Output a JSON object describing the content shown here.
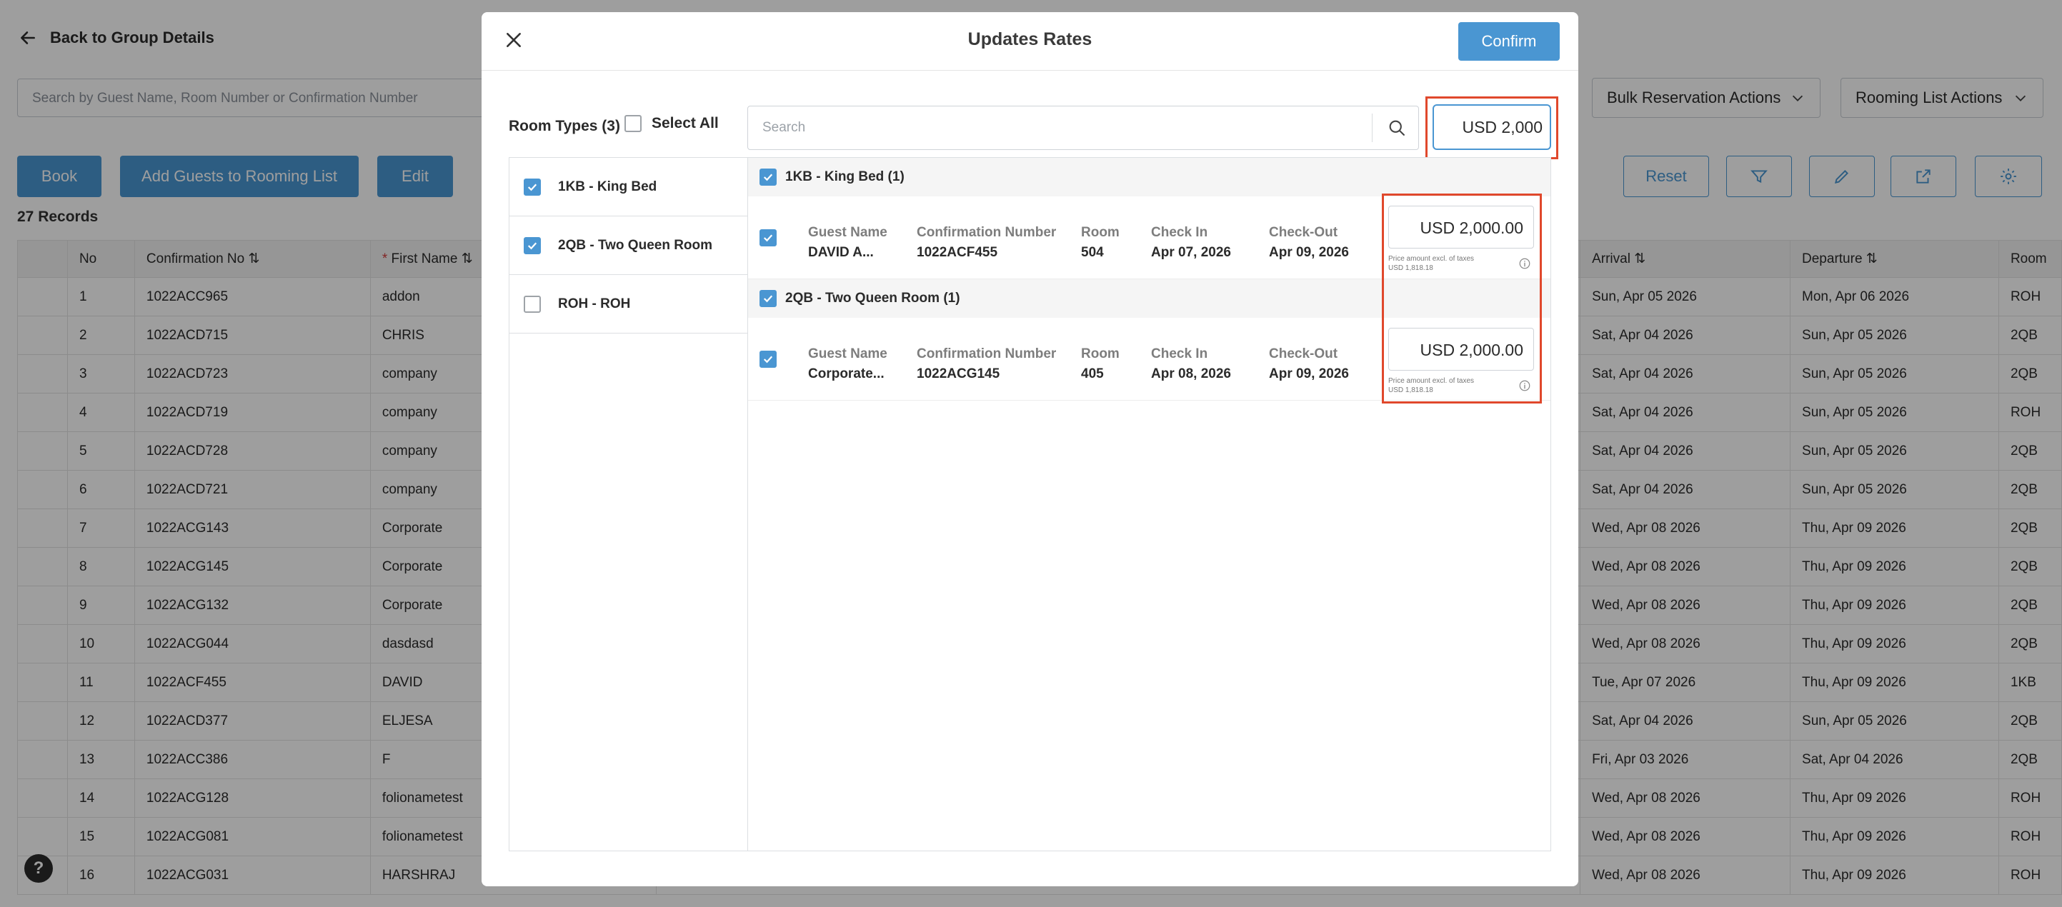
{
  "background": {
    "back_link": "Back to Group Details",
    "search_placeholder": "Search by Guest Name, Room Number or Confirmation Number",
    "bulk_actions": "Bulk Reservation Actions",
    "rooming_actions": "Rooming List Actions",
    "buttons": {
      "book": "Book",
      "add_guests": "Add Guests to Rooming List",
      "edit": "Edit",
      "reset": "Reset"
    },
    "records": "27 Records",
    "columns": {
      "no": "No",
      "confirmation": "Confirmation No",
      "first_name": "First Name",
      "arrival": "Arrival",
      "departure": "Departure",
      "room": "Room"
    },
    "rows": [
      {
        "no": "1",
        "conf": "1022ACC965",
        "first": "addon",
        "arrival": "Sun, Apr 05 2026",
        "departure": "Mon, Apr 06 2026",
        "room": "ROH"
      },
      {
        "no": "2",
        "conf": "1022ACD715",
        "first": "CHRIS",
        "arrival": "Sat, Apr 04 2026",
        "departure": "Sun, Apr 05 2026",
        "room": "2QB"
      },
      {
        "no": "3",
        "conf": "1022ACD723",
        "first": "company",
        "arrival": "Sat, Apr 04 2026",
        "departure": "Sun, Apr 05 2026",
        "room": "2QB"
      },
      {
        "no": "4",
        "conf": "1022ACD719",
        "first": "company",
        "arrival": "Sat, Apr 04 2026",
        "departure": "Sun, Apr 05 2026",
        "room": "ROH"
      },
      {
        "no": "5",
        "conf": "1022ACD728",
        "first": "company",
        "arrival": "Sat, Apr 04 2026",
        "departure": "Sun, Apr 05 2026",
        "room": "2QB"
      },
      {
        "no": "6",
        "conf": "1022ACD721",
        "first": "company",
        "arrival": "Sat, Apr 04 2026",
        "departure": "Sun, Apr 05 2026",
        "room": "2QB"
      },
      {
        "no": "7",
        "conf": "1022ACG143",
        "first": "Corporate",
        "arrival": "Wed, Apr 08 2026",
        "departure": "Thu, Apr 09 2026",
        "room": "2QB"
      },
      {
        "no": "8",
        "conf": "1022ACG145",
        "first": "Corporate",
        "arrival": "Wed, Apr 08 2026",
        "departure": "Thu, Apr 09 2026",
        "room": "2QB"
      },
      {
        "no": "9",
        "conf": "1022ACG132",
        "first": "Corporate",
        "arrival": "Wed, Apr 08 2026",
        "departure": "Thu, Apr 09 2026",
        "room": "2QB"
      },
      {
        "no": "10",
        "conf": "1022ACG044",
        "first": "dasdasd",
        "arrival": "Wed, Apr 08 2026",
        "departure": "Thu, Apr 09 2026",
        "room": "2QB"
      },
      {
        "no": "11",
        "conf": "1022ACF455",
        "first": "DAVID",
        "arrival": "Tue, Apr 07 2026",
        "departure": "Thu, Apr 09 2026",
        "room": "1KB"
      },
      {
        "no": "12",
        "conf": "1022ACD377",
        "first": "ELJESA",
        "arrival": "Sat, Apr 04 2026",
        "departure": "Sun, Apr 05 2026",
        "room": "2QB"
      },
      {
        "no": "13",
        "conf": "1022ACC386",
        "first": "F",
        "arrival": "Fri, Apr 03 2026",
        "departure": "Sat, Apr 04 2026",
        "room": "2QB"
      },
      {
        "no": "14",
        "conf": "1022ACG128",
        "first": "folionametest",
        "arrival": "Wed, Apr 08 2026",
        "departure": "Thu, Apr 09 2026",
        "room": "ROH"
      },
      {
        "no": "15",
        "conf": "1022ACG081",
        "first": "folionametest",
        "arrival": "Wed, Apr 08 2026",
        "departure": "Thu, Apr 09 2026",
        "room": "ROH"
      },
      {
        "no": "16",
        "conf": "1022ACG031",
        "first": "HARSHRAJ",
        "arrival": "Wed, Apr 08 2026",
        "departure": "Thu, Apr 09 2026",
        "room": "ROH"
      }
    ]
  },
  "modal": {
    "title": "Updates Rates",
    "confirm": "Confirm",
    "room_types_label": "Room Types (3)",
    "select_all": "Select All",
    "search_placeholder": "Search",
    "global_rate": "USD 2,000",
    "room_types": [
      {
        "label": "1KB - King Bed",
        "checked": true
      },
      {
        "label": "2QB - Two Queen Room",
        "checked": true
      },
      {
        "label": "ROH - ROH",
        "checked": false
      }
    ],
    "col_headers": {
      "guest": "Guest Name",
      "conf": "Confirmation Number",
      "room": "Room",
      "checkin": "Check In",
      "checkout": "Check-Out"
    },
    "groups": [
      {
        "title": "1KB - King Bed (1)",
        "row": {
          "guest": "DAVID A...",
          "conf": "1022ACF455",
          "room": "504",
          "checkin": "Apr 07, 2026",
          "checkout": "Apr 09, 2026",
          "price": "USD 2,000.00",
          "note1": "Price amount excl. of taxes",
          "note2": "USD 1,818.18"
        }
      },
      {
        "title": "2QB - Two Queen Room (1)",
        "row": {
          "guest": "Corporate...",
          "conf": "1022ACG145",
          "room": "405",
          "checkin": "Apr 08, 2026",
          "checkout": "Apr 09, 2026",
          "price": "USD 2,000.00",
          "note1": "Price amount excl. of taxes",
          "note2": "USD 1,818.18"
        }
      }
    ]
  },
  "help_label": "?",
  "colors": {
    "accent": "#4a96d2",
    "highlight": "#e0482c"
  }
}
